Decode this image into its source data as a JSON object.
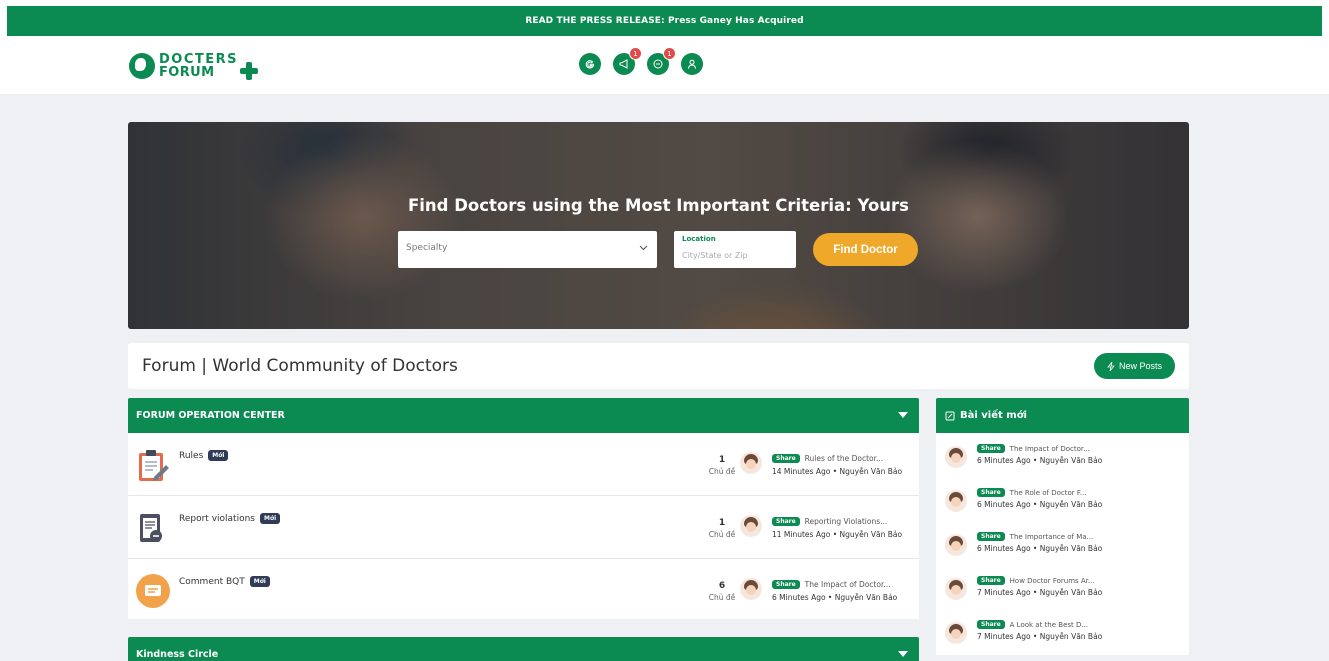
{
  "banner": {
    "text": "READ THE PRESS RELEASE: Press Ganey Has Acquired"
  },
  "logo": {
    "line1": "DOCTERS",
    "line2": "FORUM"
  },
  "header_icons": [
    {
      "icon": "google-icon",
      "badge": ""
    },
    {
      "icon": "megaphone-icon",
      "badge": "1"
    },
    {
      "icon": "chat-icon",
      "badge": "1"
    },
    {
      "icon": "user-icon",
      "badge": ""
    }
  ],
  "hero": {
    "title": "Find Doctors using the Most Important Criteria: Yours",
    "specialty_placeholder": "Specialty",
    "location_label": "Location",
    "location_placeholder": "City/State or Zip",
    "find_button": "Find Doctor"
  },
  "forum": {
    "title": "Forum | World Community of Doctors",
    "new_posts_label": "New Posts"
  },
  "sections": [
    {
      "title": "FORUM OPERATION CENTER"
    },
    {
      "title": "Kindness Circle"
    }
  ],
  "forums": [
    {
      "name": "Rules",
      "badge": "Mới",
      "count": "1",
      "count_label": "Chủ đề",
      "tag": "Share",
      "post_title": "Rules of the Doctor...",
      "time": "14 Minutes Ago",
      "author": "Nguyễn Văn Bảo"
    },
    {
      "name": "Report violations",
      "badge": "Mới",
      "count": "1",
      "count_label": "Chủ đề",
      "tag": "Share",
      "post_title": "Reporting Violations...",
      "time": "11 Minutes Ago",
      "author": "Nguyễn Văn Bảo"
    },
    {
      "name": "Comment BQT",
      "badge": "Mới",
      "count": "6",
      "count_label": "Chủ đề",
      "tag": "Share",
      "post_title": "The Impact of Doctor...",
      "time": "6 Minutes Ago",
      "author": "Nguyễn Văn Bảo"
    }
  ],
  "sidebar": {
    "title": "Bài viết mới",
    "items": [
      {
        "tag": "Share",
        "title": "The Impact of Doctor...",
        "time": "6 Minutes Ago",
        "author": "Nguyễn Văn Bảo"
      },
      {
        "tag": "Share",
        "title": "The Role of Doctor F...",
        "time": "6 Minutes Ago",
        "author": "Nguyễn Văn Bảo"
      },
      {
        "tag": "Share",
        "title": "The Importance of Ma...",
        "time": "6 Minutes Ago",
        "author": "Nguyễn Văn Bảo"
      },
      {
        "tag": "Share",
        "title": "How Doctor Forums Ar...",
        "time": "7 Minutes Ago",
        "author": "Nguyễn Văn Bảo"
      },
      {
        "tag": "Share",
        "title": "A Look at the Best D...",
        "time": "7 Minutes Ago",
        "author": "Nguyễn Văn Bảo"
      }
    ]
  },
  "colors": {
    "brand": "#0b8a52",
    "accent": "#f0a82a",
    "badge_dark": "#2f3b57",
    "notification": "#e24a4a"
  }
}
